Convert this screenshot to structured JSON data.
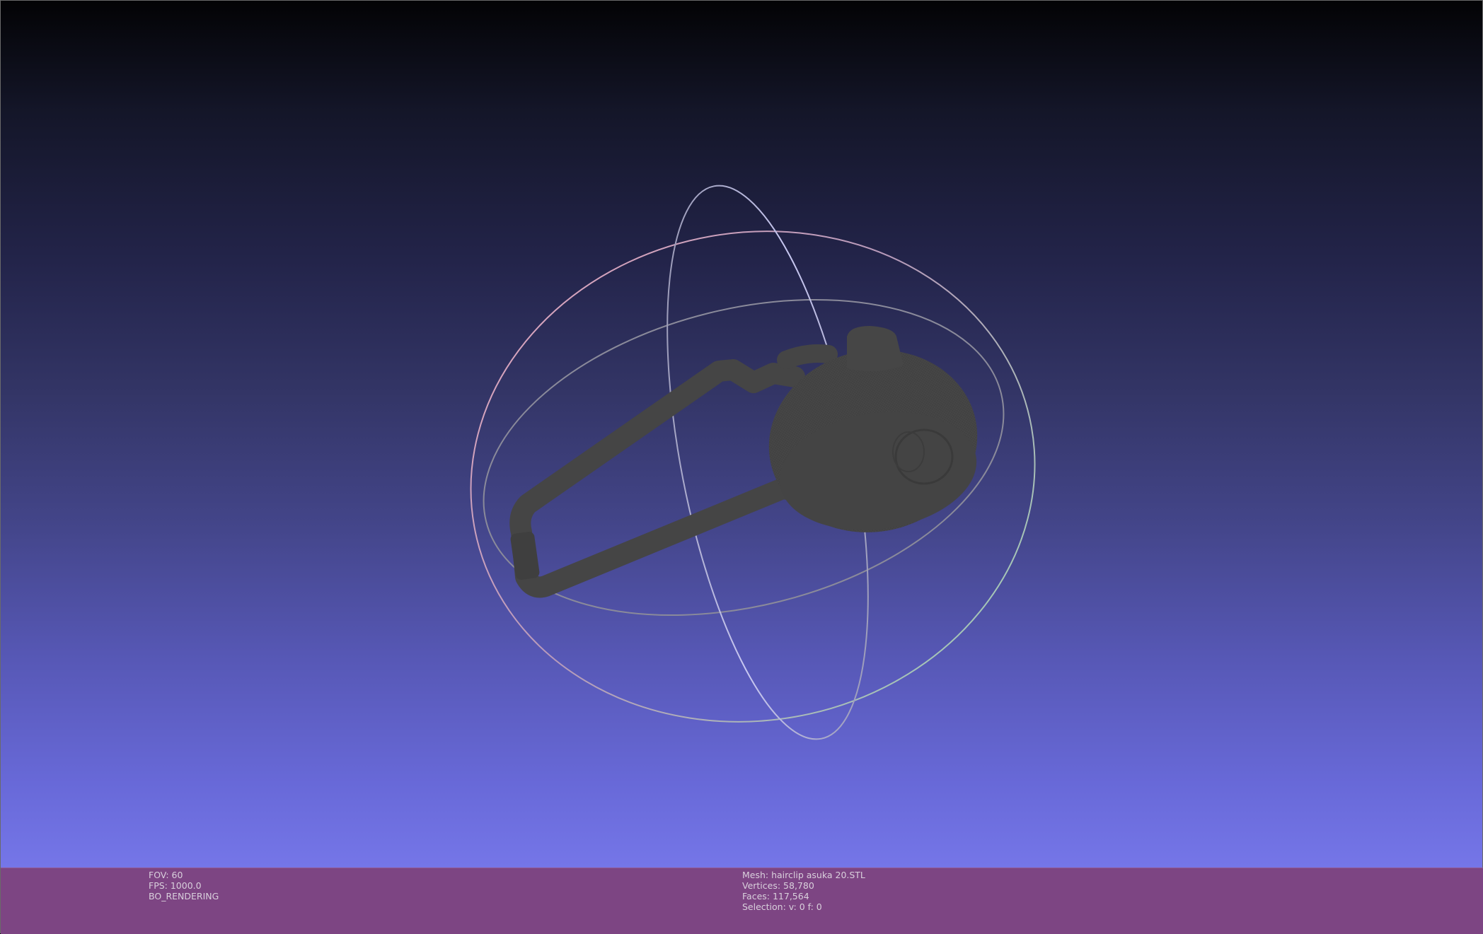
{
  "viewport": {
    "colors": {
      "background_top": "#030305",
      "background_bottom": "#7778eb",
      "mesh": "#454545",
      "trackball_pink": "#e6a9bf",
      "trackball_green": "#9fd6b5",
      "trackball_lavender": "#c8c8f2",
      "trackball_gray": "#8a8a9a",
      "info_bar": "#7d4583"
    },
    "objects": {
      "mesh_icon": "hairclip-mesh",
      "trackball_icon": "trackball-gizmo"
    }
  },
  "info": {
    "left": {
      "fov": "FOV: 60",
      "fps": "FPS:  1000.0",
      "mode": "BO_RENDERING"
    },
    "right": {
      "mesh": "Mesh: hairclip asuka 20.STL",
      "vertices": "Vertices: 58,780",
      "faces": "Faces: 117,564",
      "selection": "Selection: v: 0 f: 0"
    }
  }
}
